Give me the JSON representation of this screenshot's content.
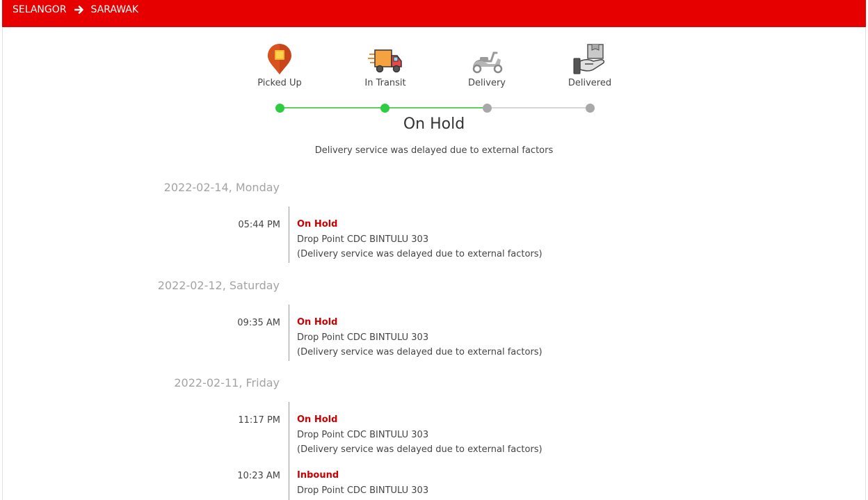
{
  "header": {
    "origin": "SELANGOR",
    "destination": "SARAWAK",
    "bar_color": "#e60000"
  },
  "progress": {
    "steps": [
      {
        "label": "Picked Up",
        "icon": "location-pin-icon",
        "state": "done"
      },
      {
        "label": "In Transit",
        "icon": "delivery-truck-icon",
        "state": "done"
      },
      {
        "label": "Delivery",
        "icon": "scooter-icon",
        "state": "pending"
      },
      {
        "label": "Delivered",
        "icon": "package-in-hand-icon",
        "state": "pending"
      }
    ],
    "completed_steps": 2,
    "done_color": "#2ecc40",
    "pending_color": "#a8a8a8"
  },
  "status": {
    "title": "On Hold",
    "description": "Delivery service was delayed due to external factors"
  },
  "timeline": [
    {
      "date": "2022-02-14, Monday",
      "events": [
        {
          "time": "05:44 PM",
          "status": "On Hold",
          "location": "Drop Point CDC BINTULU 303",
          "note": "(Delivery service was delayed due to external factors)"
        }
      ]
    },
    {
      "date": "2022-02-12, Saturday",
      "events": [
        {
          "time": "09:35 AM",
          "status": "On Hold",
          "location": "Drop Point CDC BINTULU 303",
          "note": "(Delivery service was delayed due to external factors)"
        }
      ]
    },
    {
      "date": "2022-02-11, Friday",
      "events": [
        {
          "time": "11:17 PM",
          "status": "On Hold",
          "location": "Drop Point CDC BINTULU 303",
          "note": "(Delivery service was delayed due to external factors)"
        },
        {
          "time": "10:23 AM",
          "status": "Inbound",
          "location": "Drop Point CDC BINTULU 303",
          "note": ""
        }
      ]
    }
  ]
}
